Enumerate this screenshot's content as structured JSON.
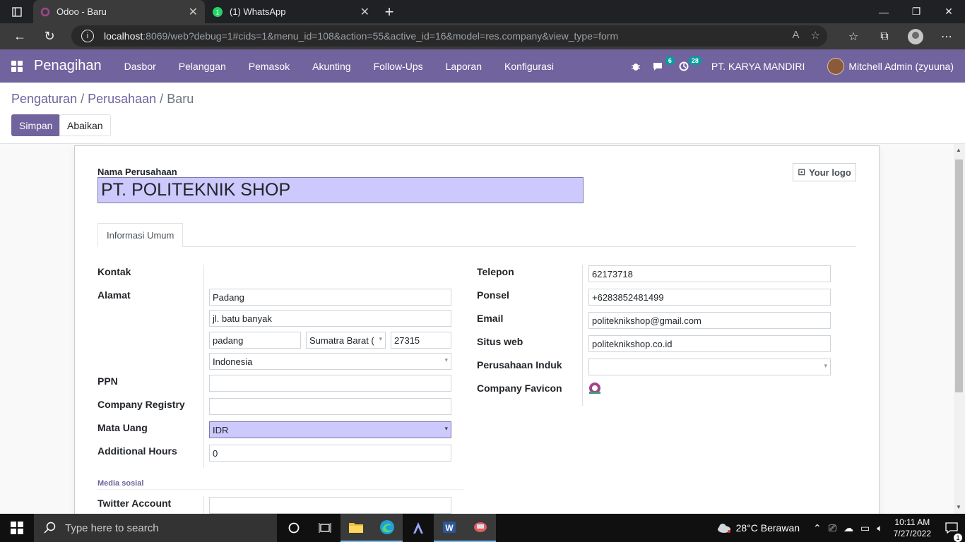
{
  "browser": {
    "tabs": [
      {
        "title": "Odoo - Baru",
        "active": true
      },
      {
        "title": "(1) WhatsApp",
        "active": false
      }
    ],
    "url_host": "localhost",
    "url_rest": ":8069/web?debug=1#cids=1&menu_id=108&action=55&active_id=16&model=res.company&view_type=form"
  },
  "navbar": {
    "brand": "Penagihan",
    "menu": [
      "Dasbor",
      "Pelanggan",
      "Pemasok",
      "Akunting",
      "Follow-Ups",
      "Laporan",
      "Konfigurasi"
    ],
    "messages_count": "6",
    "activities_count": "28",
    "company": "PT. KARYA MANDIRI",
    "user": "Mitchell Admin (zyuuna)"
  },
  "control_panel": {
    "breadcrumb": [
      "Pengaturan",
      "Perusahaan",
      "Baru"
    ],
    "save_label": "Simpan",
    "discard_label": "Abaikan"
  },
  "form": {
    "name_label": "Nama Perusahaan",
    "name_value": "PT. POLITEKNIK SHOP",
    "logo_label": "Your logo",
    "tab_label": "Informasi Umum",
    "left": {
      "contact_label": "Kontak",
      "address_label": "Alamat",
      "street": "Padang",
      "street2": "jl. batu banyak",
      "city": "padang",
      "state": "Sumatra Barat (",
      "zip": "27315",
      "country": "Indonesia",
      "vat_label": "PPN",
      "vat_value": "",
      "registry_label": "Company Registry",
      "registry_value": "",
      "currency_label": "Mata Uang",
      "currency_value": "IDR",
      "hours_label": "Additional Hours",
      "hours_value": "0",
      "social_title": "Media sosial",
      "twitter_label": "Twitter Account",
      "twitter_value": ""
    },
    "right": {
      "phone_label": "Telepon",
      "phone_value": "62173718",
      "mobile_label": "Ponsel",
      "mobile_value": "+6283852481499",
      "email_label": "Email",
      "email_value": "politeknikshop@gmail.com",
      "website_label": "Situs web",
      "website_value": "politeknikshop.co.id",
      "parent_label": "Perusahaan Induk",
      "parent_value": "",
      "favicon_label": "Company Favicon"
    }
  },
  "taskbar": {
    "search_placeholder": "Type here to search",
    "weather": "28°C  Berawan",
    "time": "10:11 AM",
    "date": "7/27/2022",
    "notification_count": "1"
  },
  "colors": {
    "odoo_purple": "#71639e",
    "highlight_input": "#cdc9fd"
  }
}
